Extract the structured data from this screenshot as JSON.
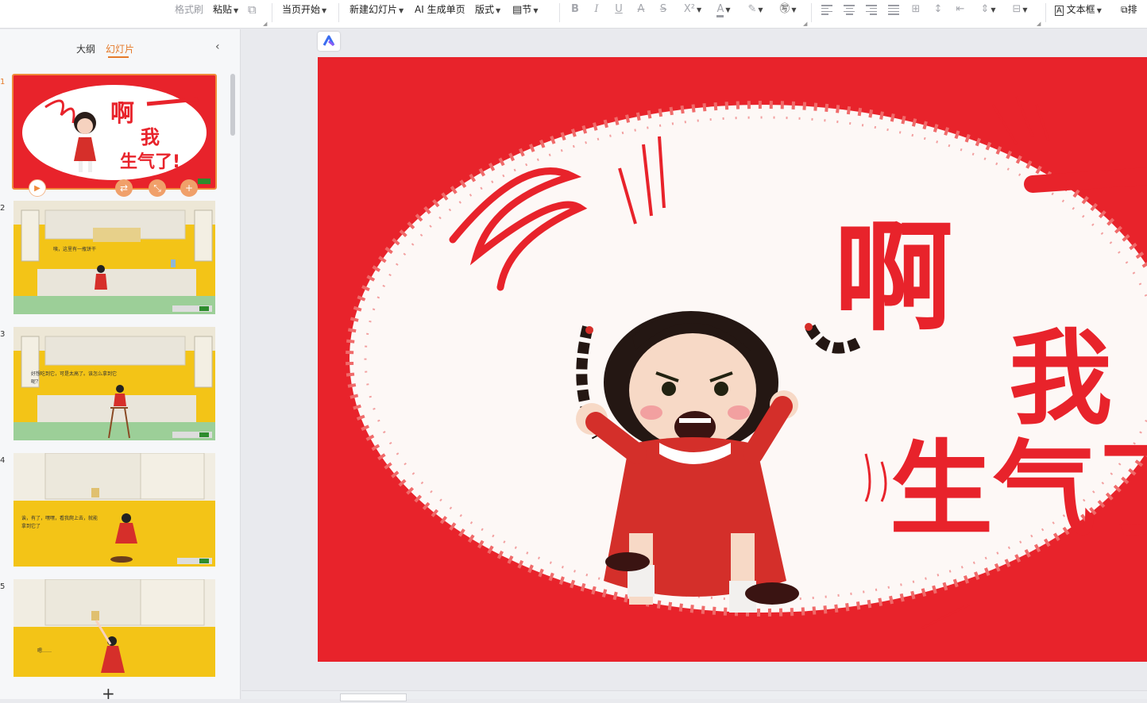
{
  "toolbar": {
    "format_painter": "格式刷",
    "paste": "粘贴",
    "from_current": "当页开始",
    "new_slide": "新建幻灯片",
    "ai_generate": "AI 生成单页",
    "layout": "版式",
    "section": "节",
    "textbox": "文本框",
    "arrange": "排"
  },
  "panel": {
    "tab_outline": "大纲",
    "tab_slides": "幻灯片",
    "add_slide": "+"
  },
  "slides": {
    "numbers": [
      "1",
      "2",
      "3",
      "4",
      "5"
    ],
    "s1_line1": "啊",
    "s1_line2": "我",
    "s1_line3": "生气了!",
    "s2_caption": "咦，这里有一瓶饼干",
    "s3_caption": "好想吃到它，可是太高了。该怎么拿到它呢？",
    "s4_caption": "诶，有了，嘿嘿，看我爬上去，就能拿到它了",
    "s5_caption": "嗯……"
  },
  "main_slide": {
    "title_1": "啊",
    "title_2": "我",
    "title_3": "生气了"
  },
  "colors": {
    "accent": "#e57a2a",
    "slide_red": "#e8232b",
    "slide_yellow": "#f3c417"
  }
}
